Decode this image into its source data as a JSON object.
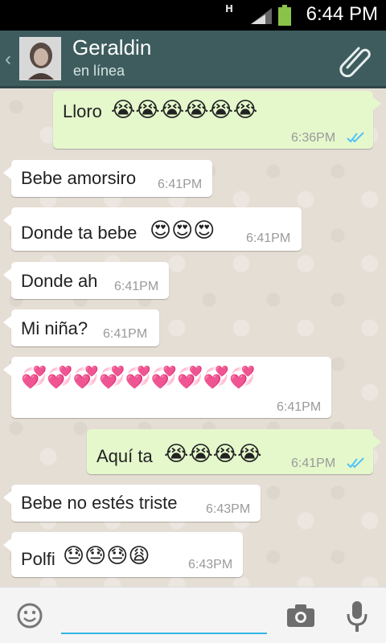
{
  "status_bar": {
    "time": "6:44 PM",
    "network": "H"
  },
  "header": {
    "name": "Geraldin",
    "status": "en línea"
  },
  "messages": [
    {
      "direction": "out",
      "text": "Lloro",
      "emoji": "😭😭😭😭😭😭",
      "time": "6:36PM",
      "read": true
    },
    {
      "direction": "in",
      "text": "Bebe amorsiro",
      "emoji": "",
      "time": "6:41PM"
    },
    {
      "direction": "in",
      "text": "Donde ta bebe",
      "emoji": "😍😍😍",
      "time": "6:41PM"
    },
    {
      "direction": "in",
      "text": "Donde ah",
      "emoji": "",
      "time": "6:41PM"
    },
    {
      "direction": "in",
      "text": "Mi niña?",
      "emoji": "",
      "time": "6:41PM"
    },
    {
      "direction": "in",
      "text": "",
      "emoji": "💞💞💞💞💞💞💞💞💞",
      "time": "6:41PM"
    },
    {
      "direction": "out",
      "text": "Aquí ta",
      "emoji": "😭😭😭😭",
      "time": "6:41PM",
      "read": true
    },
    {
      "direction": "in",
      "text": "Bebe no estés triste",
      "emoji": "",
      "time": "6:43PM"
    },
    {
      "direction": "in",
      "text": "Polfi",
      "emoji": "😓😓😓😩",
      "time": "6:43PM"
    }
  ],
  "input": {
    "placeholder": "",
    "value": ""
  },
  "colors": {
    "header": "#3e5c5e",
    "outgoing_bubble": "#e5f8cc",
    "incoming_bubble": "#ffffff",
    "read_ticks": "#4fc3f7",
    "input_underline": "#33b5e5"
  },
  "icons": [
    "back-chevron-icon",
    "attach-paperclip-icon",
    "smiley-icon",
    "camera-icon",
    "microphone-icon",
    "read-ticks-icon"
  ]
}
